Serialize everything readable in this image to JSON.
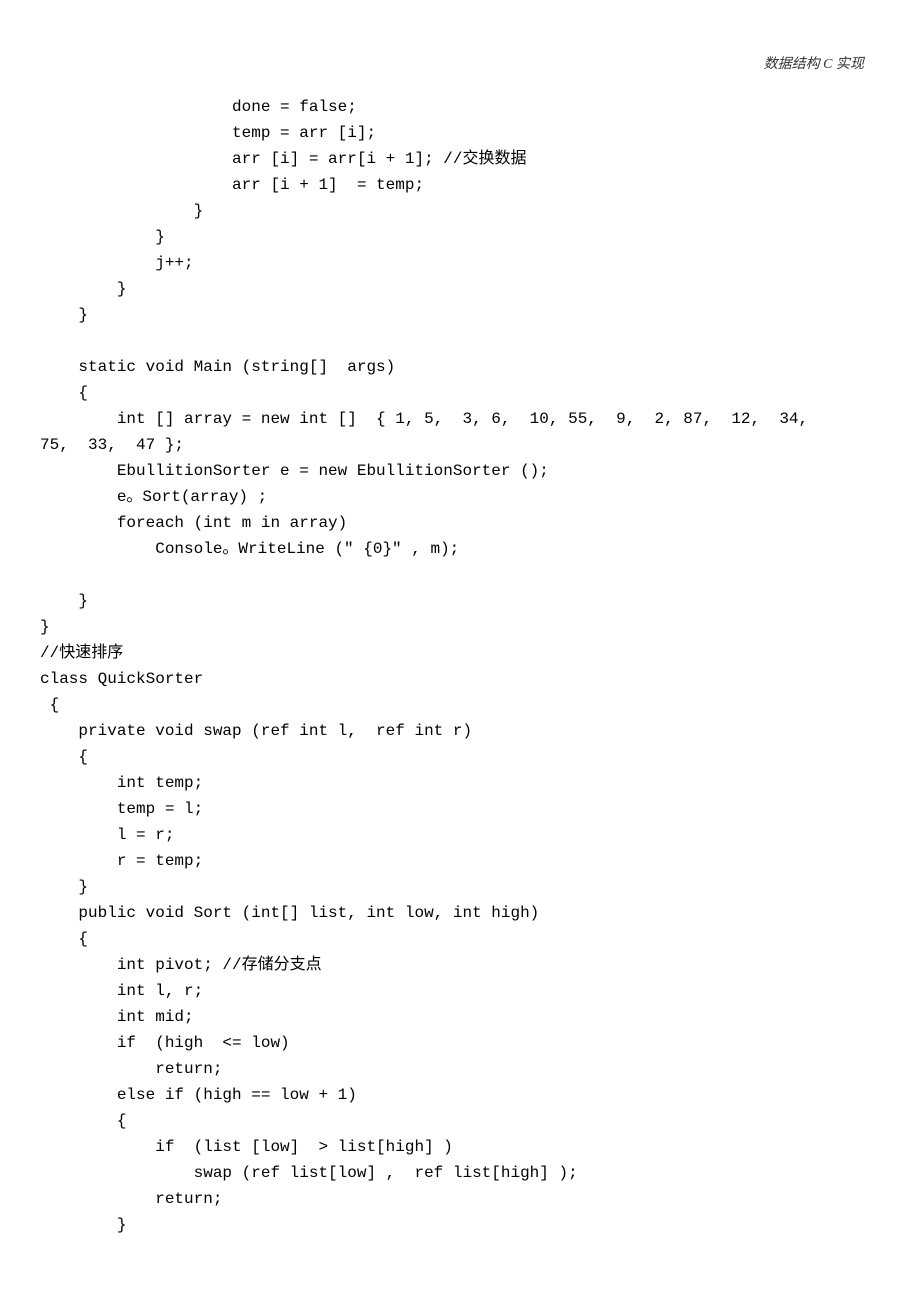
{
  "header": "数据结构 C 实现",
  "code": "                    done = false;\n                    temp = arr [i];\n                    arr [i] = arr[i + 1]; //交换数据\n                    arr [i + 1]  = temp;\n                }\n            }\n            j++;\n        }\n    }\n\n    static void Main (string[]  args)\n    {\n        int [] array = new int []  { 1, 5,  3, 6,  10, 55,  9,  2, 87,  12,  34, \n75,  33,  47 };\n        EbullitionSorter e = new EbullitionSorter ();\n        e。Sort(array) ;\n        foreach (int m in array)\n            Console。WriteLine (\" {0}\" , m);\n\n    }\n}\n//快速排序\nclass QuickSorter\n {\n    private void swap (ref int l,  ref int r)\n    {\n        int temp;\n        temp = l;\n        l = r;\n        r = temp;\n    }\n    public void Sort (int[] list, int low, int high)\n    {\n        int pivot; //存储分支点\n        int l, r;\n        int mid;\n        if  (high  <= low)\n            return;\n        else if (high == low + 1)\n        {\n            if  (list [low]  > list[high] )\n                swap (ref list[low] ,  ref list[high] );\n            return;\n        }"
}
